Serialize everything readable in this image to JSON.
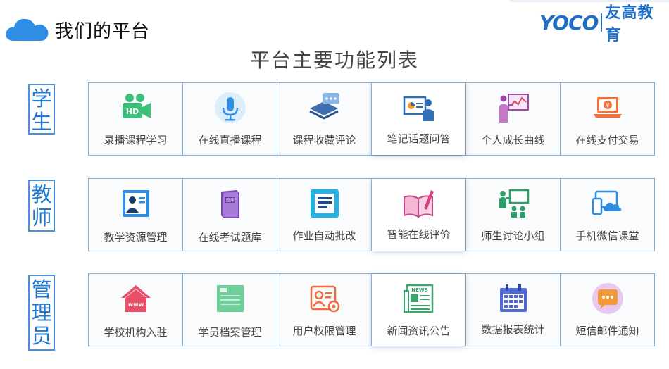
{
  "header": {
    "title": "我们的平台",
    "logo_en": "YOCO",
    "logo_cn": "友高教育"
  },
  "main_title": "平台主要功能列表",
  "colors": {
    "accent": "#1f78d1",
    "border": "#7fb0de"
  },
  "sections": [
    {
      "role": "学生",
      "items": [
        {
          "label": "录播课程学习",
          "icon": "hd-video-camera-icon"
        },
        {
          "label": "在线直播课程",
          "icon": "microphone-icon"
        },
        {
          "label": "课程收藏评论",
          "icon": "comment-bubble-icon"
        },
        {
          "label": "笔记话题问答",
          "icon": "presenter-board-icon"
        },
        {
          "label": "个人成长曲线",
          "icon": "growth-chart-icon"
        },
        {
          "label": "在线支付交易",
          "icon": "laptop-payment-icon"
        }
      ]
    },
    {
      "role": "教师",
      "items": [
        {
          "label": "教学资源管理",
          "icon": "contact-card-icon"
        },
        {
          "label": "在线考试题库",
          "icon": "question-bank-book-icon"
        },
        {
          "label": "作业自动批改",
          "icon": "document-list-icon"
        },
        {
          "label": "智能在线评价",
          "icon": "book-pen-icon"
        },
        {
          "label": "师生讨论小组",
          "icon": "teacher-board-group-icon"
        },
        {
          "label": "手机微信课堂",
          "icon": "mobile-cloud-icon"
        }
      ]
    },
    {
      "role": "管理员",
      "items": [
        {
          "label": "学校机构入驻",
          "icon": "www-house-icon"
        },
        {
          "label": "学员档案管理",
          "icon": "archive-document-icon"
        },
        {
          "label": "用户权限管理",
          "icon": "user-settings-icon"
        },
        {
          "label": "新闻资讯公告",
          "icon": "newspaper-icon"
        },
        {
          "label": "数据报表统计",
          "icon": "calendar-grid-icon"
        },
        {
          "label": "短信邮件通知",
          "icon": "message-bubble-icon"
        }
      ]
    }
  ]
}
